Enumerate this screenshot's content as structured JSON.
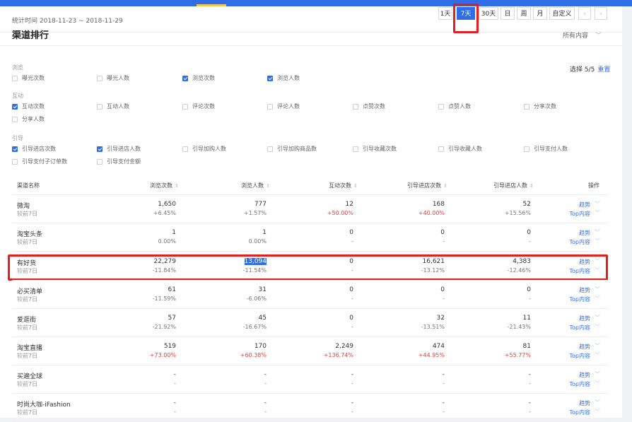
{
  "header": {
    "date_label": "统计时间 2018-11-23 ~ 2018-11-29",
    "periods": [
      {
        "label": "1天",
        "active": false
      },
      {
        "label": "7天",
        "active": true
      },
      {
        "label": "30天",
        "active": false
      },
      {
        "label": "日",
        "active": false
      },
      {
        "label": "周",
        "active": false
      },
      {
        "label": "月",
        "active": false
      },
      {
        "label": "自定义",
        "active": false
      }
    ],
    "prev_icon": "chevron-left-icon",
    "next_icon": "chevron-right-icon"
  },
  "section": {
    "title": "渠道排行",
    "filter_value": "所有内容",
    "selected_count": "选择 5/5",
    "reset_label": "重置"
  },
  "groups": [
    {
      "label": "浏览",
      "options": [
        {
          "label": "曝光次数",
          "checked": false
        },
        {
          "label": "曝光人数",
          "checked": false
        },
        {
          "label": "浏览次数",
          "checked": true
        },
        {
          "label": "浏览人数",
          "checked": true
        }
      ]
    },
    {
      "label": "互动",
      "options": [
        {
          "label": "互动次数",
          "checked": true
        },
        {
          "label": "互动人数",
          "checked": false
        },
        {
          "label": "评论次数",
          "checked": false
        },
        {
          "label": "评论人数",
          "checked": false
        },
        {
          "label": "点赞次数",
          "checked": false
        },
        {
          "label": "点赞人数",
          "checked": false
        },
        {
          "label": "分享次数",
          "checked": false
        },
        {
          "label": "分享人数",
          "checked": false
        }
      ]
    },
    {
      "label": "引导",
      "options": [
        {
          "label": "引导进店次数",
          "checked": true
        },
        {
          "label": "引导进店人数",
          "checked": true
        },
        {
          "label": "引导加购人数",
          "checked": false
        },
        {
          "label": "引导加购商品数",
          "checked": false
        },
        {
          "label": "引导收藏次数",
          "checked": false
        },
        {
          "label": "引导收藏人数",
          "checked": false
        },
        {
          "label": "引导支付人数",
          "checked": false
        },
        {
          "label": "引导支付子订单数",
          "checked": false
        },
        {
          "label": "引导支付金额",
          "checked": false
        }
      ]
    }
  ],
  "table": {
    "columns": [
      "渠道名称",
      "浏览次数",
      "浏览人数",
      "互动次数",
      "引导进店次数",
      "引导进店人数",
      "操作"
    ],
    "compare_label": "较前7日",
    "trend_label": "趋势",
    "top_label": "Top内容",
    "rows": [
      {
        "name": "微淘",
        "values": [
          "1,650",
          "777",
          "12",
          "168",
          "52"
        ],
        "pcts": [
          "+6.45%",
          "+1.57%",
          "+50.00%",
          "+40.00%",
          "+15.56%"
        ],
        "up": [
          false,
          false,
          true,
          true,
          false
        ]
      },
      {
        "name": "淘宝头条",
        "values": [
          "1",
          "1",
          "0",
          "0",
          "0"
        ],
        "pcts": [
          "0.00%",
          "0.00%",
          "-",
          "-",
          "-"
        ],
        "up": [
          false,
          false,
          false,
          false,
          false
        ]
      },
      {
        "name": "有好货",
        "values": [
          "22,279",
          "13,094",
          "0",
          "16,621",
          "4,383"
        ],
        "pcts": [
          "-11.84%",
          "-11.54%",
          "-",
          "-13.12%",
          "-12.46%"
        ],
        "up": [
          false,
          false,
          false,
          false,
          false
        ]
      },
      {
        "name": "必买清单",
        "values": [
          "61",
          "31",
          "0",
          "0",
          "0"
        ],
        "pcts": [
          "-11.59%",
          "-6.06%",
          "-",
          "-",
          "-"
        ],
        "up": [
          false,
          false,
          false,
          false,
          false
        ]
      },
      {
        "name": "爱逛街",
        "values": [
          "57",
          "45",
          "0",
          "32",
          "11"
        ],
        "pcts": [
          "-21.92%",
          "-16.67%",
          "-",
          "-13.51%",
          "-21.43%"
        ],
        "up": [
          false,
          false,
          false,
          false,
          false
        ]
      },
      {
        "name": "淘宝直播",
        "values": [
          "519",
          "170",
          "2,249",
          "474",
          "81"
        ],
        "pcts": [
          "+73.00%",
          "+60.38%",
          "+136.74%",
          "+44.95%",
          "+55.77%"
        ],
        "up": [
          true,
          true,
          true,
          true,
          true
        ]
      },
      {
        "name": "买遍全球",
        "values": [
          "-",
          "-",
          "-",
          "-",
          "-"
        ],
        "pcts": [
          "-",
          "-",
          "-",
          "-",
          "-"
        ],
        "up": [
          false,
          false,
          false,
          false,
          false
        ]
      },
      {
        "name": "时尚大咖-iFashion",
        "values": [
          "-",
          "-",
          "-",
          "-",
          "-"
        ],
        "pcts": [
          "-",
          "-",
          "-",
          "-",
          "-"
        ],
        "up": [
          false,
          false,
          false,
          false,
          false
        ]
      }
    ]
  }
}
